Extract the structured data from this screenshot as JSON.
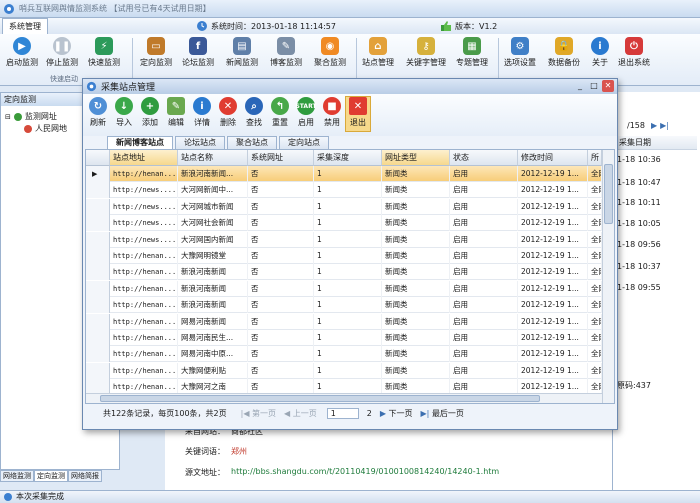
{
  "app": {
    "title": "哨兵互联网舆情监测系统 【试用号已有4天试用日期】"
  },
  "topbar": {
    "menu_tab": "系统管理",
    "system_time": "系统时间：2013-01-18 11:14:57",
    "version": "版本：V1.2"
  },
  "toolbar": {
    "buttons": [
      "启动监测",
      "停止监测",
      "快速监测",
      "定向监测",
      "论坛监测",
      "新闻监测",
      "博客监测",
      "聚合监测",
      "站点管理",
      "关键字管理",
      "专题管理",
      "选项设置",
      "数据备份",
      "关于",
      "退出系统"
    ],
    "groups": [
      "快速启动",
      "",
      "",
      "",
      ""
    ]
  },
  "left_panel": {
    "header": "定向监测",
    "tree": [
      "监测网址",
      "人民网地"
    ],
    "tabs": [
      "网络监测",
      "定向监测",
      "网络简报"
    ]
  },
  "right_strip": {
    "pager": "/158",
    "col_header": "采集日期",
    "dates": [
      "1-18 10:36",
      "1-18 10:47",
      "1-18 10:11",
      "1-18 10:05",
      "1-18 09:56",
      "1-18 10:37",
      "1-18 09:55"
    ],
    "tail": "原码:437"
  },
  "detail": {
    "rows": [
      {
        "k": "采自网站：",
        "v": "商都社区"
      },
      {
        "k": "关键词语：",
        "v": "郑州"
      },
      {
        "k": "源文地址：",
        "v": "http://bbs.shangdu.com/t/20110419/0100100814240/14240-1.htm"
      }
    ]
  },
  "statusbar": {
    "text": "本次采集完成"
  },
  "dialog": {
    "title": "采集站点管理",
    "buttons": [
      "刷新",
      "导入",
      "添加",
      "编辑",
      "详情",
      "删除",
      "查找",
      "重置",
      "启用",
      "禁用",
      "退出"
    ],
    "tabs": [
      "新闻博客站点",
      "论坛站点",
      "聚合站点",
      "定向站点"
    ],
    "columns": [
      "站点地址",
      "站点名称",
      "系统网址",
      "采集深度",
      "网址类型",
      "状态",
      "修改时间",
      "所"
    ],
    "rows": [
      [
        "http://henan...",
        "新浪河南新闻...",
        "否",
        "1",
        "新闻类",
        "启用",
        "2012-12-19 1...",
        "全网"
      ],
      [
        "http://news....",
        "大河网新闻中...",
        "否",
        "1",
        "新闻类",
        "启用",
        "2012-12-19 1...",
        "全网"
      ],
      [
        "http://news....",
        "大河网城市新闻",
        "否",
        "1",
        "新闻类",
        "启用",
        "2012-12-19 1...",
        "全网"
      ],
      [
        "http://news....",
        "大河网社会新闻",
        "否",
        "1",
        "新闻类",
        "启用",
        "2012-12-19 1...",
        "全网"
      ],
      [
        "http://news....",
        "大河网国内新闻",
        "否",
        "1",
        "新闻类",
        "启用",
        "2012-12-19 1...",
        "全网"
      ],
      [
        "http://henan...",
        "大豫网明镜堂",
        "否",
        "1",
        "新闻类",
        "启用",
        "2012-12-19 1...",
        "全网"
      ],
      [
        "http://henan...",
        "新浪河南新闻",
        "否",
        "1",
        "新闻类",
        "启用",
        "2012-12-19 1...",
        "全网"
      ],
      [
        "http://henan...",
        "新浪河南新闻",
        "否",
        "1",
        "新闻类",
        "启用",
        "2012-12-19 1...",
        "全网"
      ],
      [
        "http://henan...",
        "新浪河南新闻",
        "否",
        "1",
        "新闻类",
        "启用",
        "2012-12-19 1...",
        "全网"
      ],
      [
        "http://henan...",
        "网易河南新闻",
        "否",
        "1",
        "新闻类",
        "启用",
        "2012-12-19 1...",
        "全网"
      ],
      [
        "http://henan...",
        "网易河南民生...",
        "否",
        "1",
        "新闻类",
        "启用",
        "2012-12-19 1...",
        "全网"
      ],
      [
        "http://henan...",
        "网易河南中原...",
        "否",
        "1",
        "新闻类",
        "启用",
        "2012-12-19 1...",
        "全网"
      ],
      [
        "http://henan...",
        "大豫网便利贴",
        "否",
        "1",
        "新闻类",
        "启用",
        "2012-12-19 1...",
        "全网"
      ],
      [
        "http://henan...",
        "大豫网河之南",
        "否",
        "1",
        "新闻类",
        "启用",
        "2012-12-19 1...",
        "全网"
      ]
    ],
    "pager": {
      "summary": "共122条记录，每页100条，共2页",
      "first": "第一页",
      "prev": "上一页",
      "page_value": "1",
      "page2": "2",
      "next": "下一页",
      "last": "最后一页"
    }
  },
  "colors": {
    "accent": "#4a7fc1",
    "selected_row": "#f7cd79",
    "active_btn": "#f7d98b"
  }
}
